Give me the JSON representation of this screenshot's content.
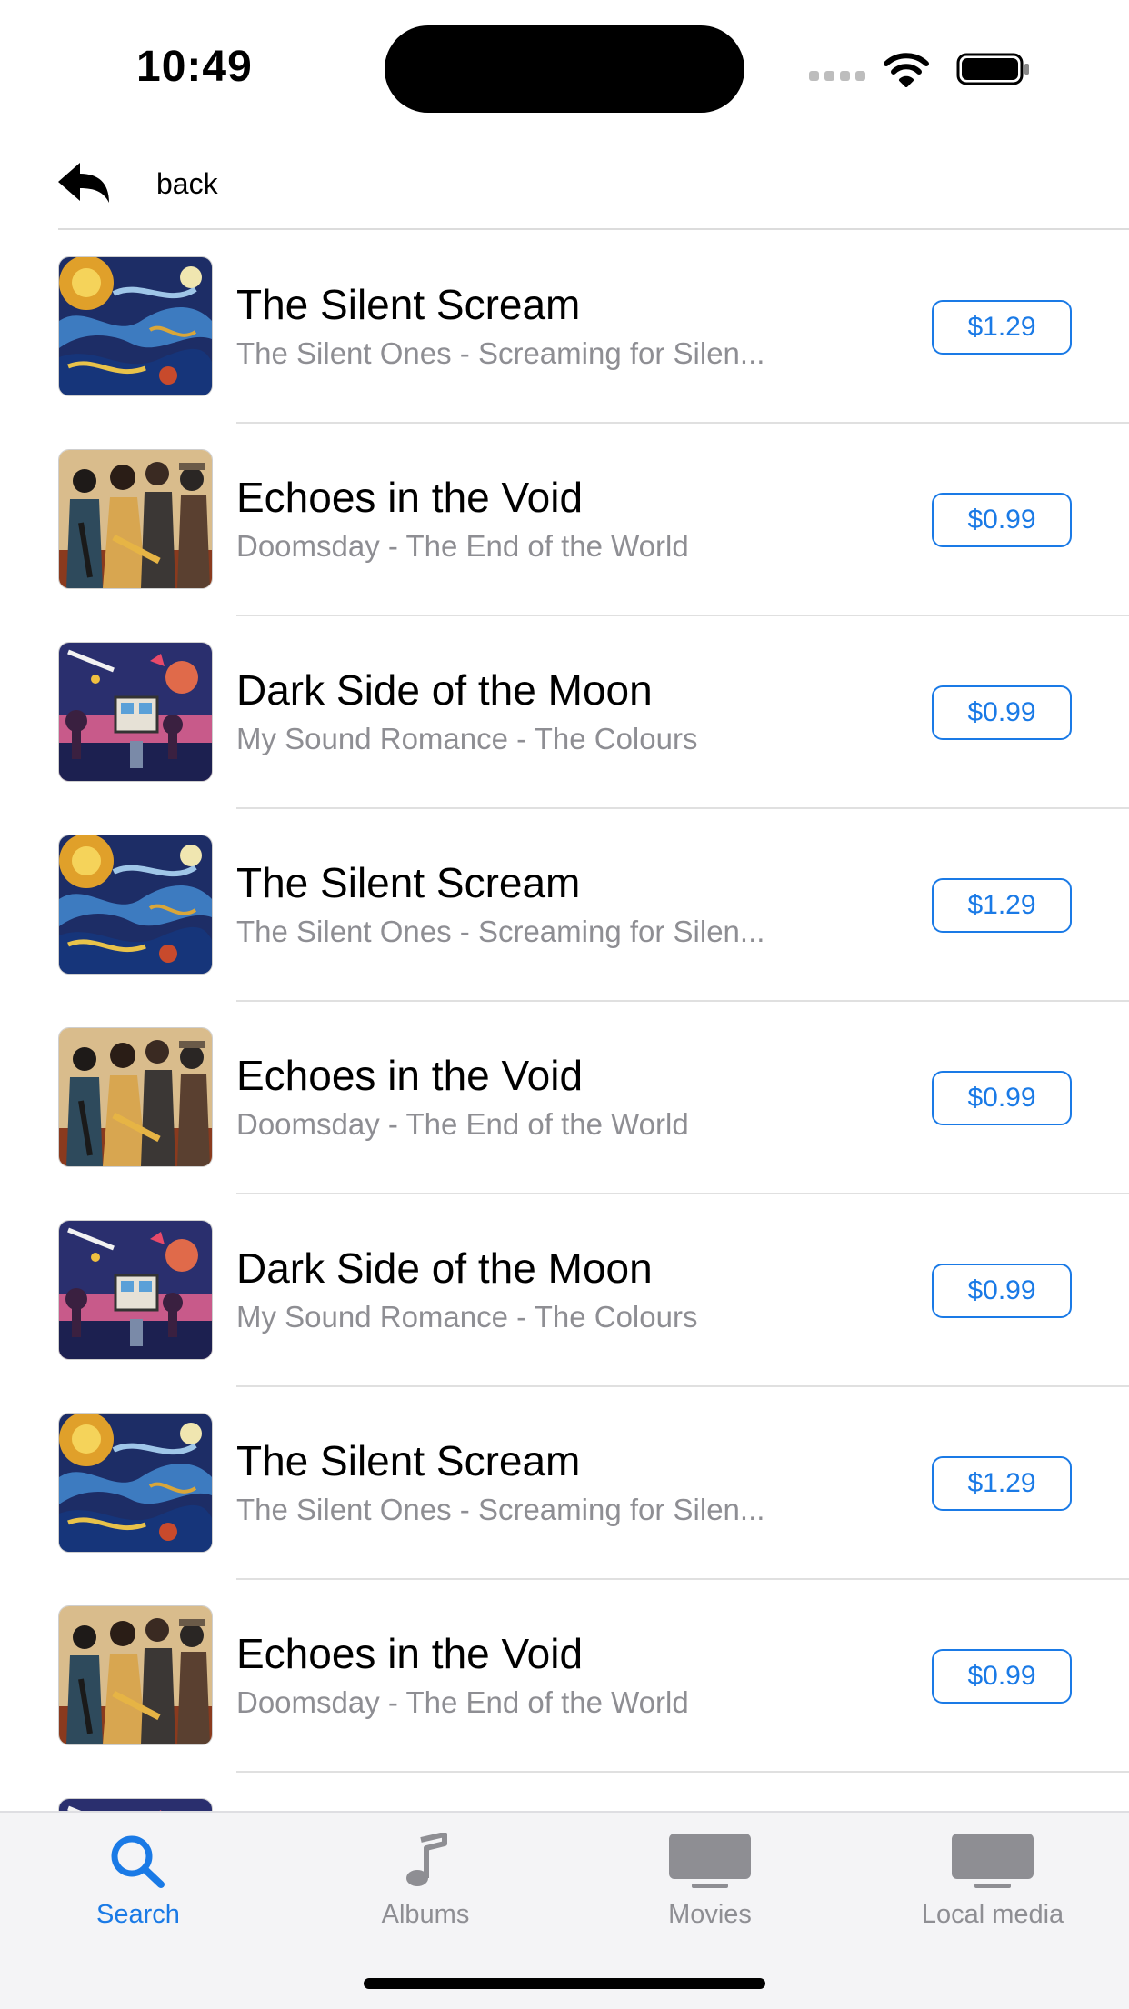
{
  "status_bar": {
    "time": "10:49",
    "icons": [
      "cellular-signal-icon",
      "wifi-icon",
      "battery-icon"
    ]
  },
  "nav": {
    "back_label": "back",
    "back_icon": "reply-arrow-icon"
  },
  "colors": {
    "accent": "#1a7ae6",
    "secondary_text": "#8e8e93",
    "separator": "#e0e0e0",
    "tab_bar_background": "#f4f4f6"
  },
  "tracks": [
    {
      "title": "The Silent Scream",
      "subtitle": "The Silent Ones - Screaming for Silen...",
      "price": "$1.29",
      "artwork": "swirl-artwork"
    },
    {
      "title": "Echoes in the Void",
      "subtitle": "Doomsday - The End of the World",
      "price": "$0.99",
      "artwork": "jazz-band-artwork"
    },
    {
      "title": "Dark Side of the Moon",
      "subtitle": "My Sound Romance - The Colours",
      "price": "$0.99",
      "artwork": "retro-city-artwork"
    },
    {
      "title": "The Silent Scream",
      "subtitle": "The Silent Ones - Screaming for Silen...",
      "price": "$1.29",
      "artwork": "swirl-artwork"
    },
    {
      "title": "Echoes in the Void",
      "subtitle": "Doomsday - The End of the World",
      "price": "$0.99",
      "artwork": "jazz-band-artwork"
    },
    {
      "title": "Dark Side of the Moon",
      "subtitle": "My Sound Romance - The Colours",
      "price": "$0.99",
      "artwork": "retro-city-artwork"
    },
    {
      "title": "The Silent Scream",
      "subtitle": "The Silent Ones - Screaming for Silen...",
      "price": "$1.29",
      "artwork": "swirl-artwork"
    },
    {
      "title": "Echoes in the Void",
      "subtitle": "Doomsday - The End of the World",
      "price": "$0.99",
      "artwork": "jazz-band-artwork"
    },
    {
      "title": "",
      "subtitle": "",
      "price": "",
      "artwork": "retro-city-artwork"
    }
  ],
  "tabs": [
    {
      "label": "Search",
      "icon": "search-icon",
      "active": true
    },
    {
      "label": "Albums",
      "icon": "music-note-icon",
      "active": false
    },
    {
      "label": "Movies",
      "icon": "tv-icon",
      "active": false
    },
    {
      "label": "Local media",
      "icon": "tv-icon",
      "active": false
    }
  ]
}
